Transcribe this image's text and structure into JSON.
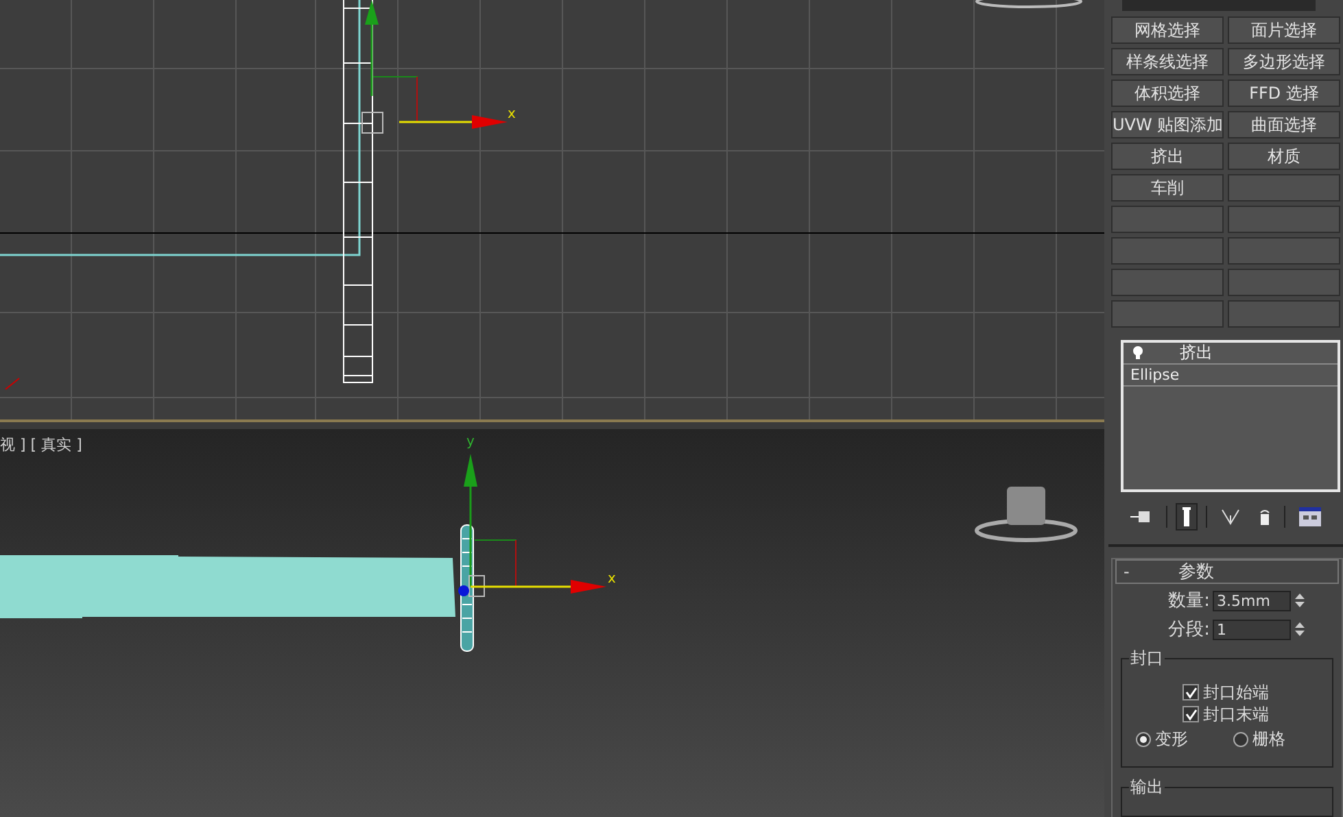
{
  "top_viewport": {
    "axis_label": "x"
  },
  "bottom_viewport": {
    "label": "视 ] [ 真实 ]",
    "axis_labels": [
      "y",
      "x"
    ]
  },
  "command_panel": {
    "modifier_buttons": [
      {
        "label": "网格选择"
      },
      {
        "label": "面片选择"
      },
      {
        "label": "样条线选择"
      },
      {
        "label": "多边形选择"
      },
      {
        "label": "体积选择"
      },
      {
        "label": "FFD 选择"
      },
      {
        "label": "UVW 贴图添加"
      },
      {
        "label": "曲面选择"
      },
      {
        "label": "挤出"
      },
      {
        "label": "材质"
      },
      {
        "label": "车削"
      }
    ],
    "modifier_stack": [
      {
        "label": "挤出",
        "kind": "modifier"
      },
      {
        "label": "Ellipse",
        "kind": "base"
      }
    ],
    "stack_tools": [
      {
        "kind": "pin",
        "selected": false
      },
      {
        "kind": "show-end",
        "selected": true
      },
      {
        "kind": "unique",
        "selected": false
      },
      {
        "kind": "remove",
        "selected": false
      },
      {
        "kind": "configure",
        "selected": false
      }
    ],
    "parameters": {
      "collapse": "-",
      "title": "参数",
      "fields": [
        {
          "label": "数量:",
          "value": "3.5mm"
        },
        {
          "label": "分段:",
          "value": "1"
        }
      ],
      "capping": {
        "title": "封口",
        "checkboxes": [
          {
            "label": "封口始端",
            "checked": true
          },
          {
            "label": "封口末端",
            "checked": true
          }
        ],
        "radios": [
          {
            "label": "变形",
            "selected": true
          },
          {
            "label": "栅格",
            "selected": false
          }
        ]
      },
      "output": {
        "title": "输出"
      }
    }
  }
}
